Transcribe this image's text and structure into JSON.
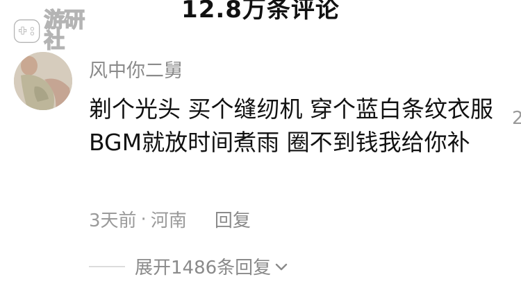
{
  "header": {
    "comment_count": "12.8万条评论"
  },
  "watermark": {
    "text": "游研社"
  },
  "comment": {
    "username": "风中你二舅",
    "body": "剃个光头 买个缝纫机 穿个蓝白条纹衣服 BGM就放时间煮雨 圈不到钱我给你补",
    "time": "3天前",
    "separator": "·",
    "location": "河南",
    "reply_label": "回复",
    "side_like_count": "2"
  },
  "replies": {
    "expand_label": "展开1486条回复"
  },
  "icons": {
    "expand": "chevron-down-icon",
    "avatar": "avatar"
  },
  "colors": {
    "text_primary": "#111111",
    "text_secondary": "#8a8a8a",
    "background": "#ffffff"
  }
}
